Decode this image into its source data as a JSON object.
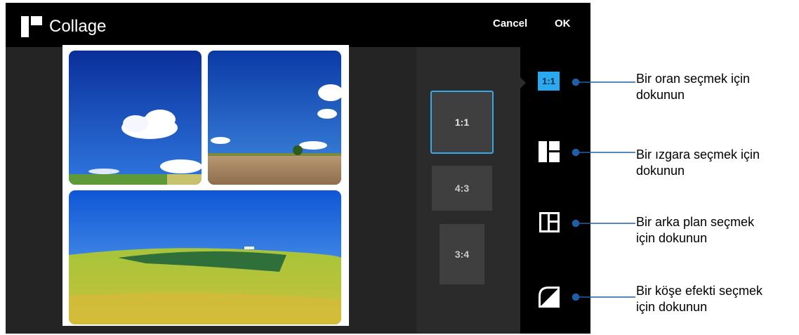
{
  "header": {
    "title": "Collage",
    "cancel_label": "Cancel",
    "ok_label": "OK"
  },
  "ratios": {
    "options": [
      "1:1",
      "4:3",
      "3:4"
    ],
    "selected": "1:1"
  },
  "tools": {
    "ratio_label": "1:1",
    "icons": [
      "ratio-icon",
      "grid-icon",
      "background-icon",
      "corner-effect-icon"
    ]
  },
  "annotations": [
    {
      "line1": "Bir oran seçmek için",
      "line2": "dokunun"
    },
    {
      "line1": "Bir ızgara seçmek için",
      "line2": "dokunun"
    },
    {
      "line1": "Bir arka plan seçmek",
      "line2": "için dokunun"
    },
    {
      "line1": "Bir köşe efekti seçmek",
      "line2": "için dokunun"
    }
  ],
  "colors": {
    "accent": "#29aaf0",
    "selection_border": "#3aa8e8",
    "callout_line": "#1f5fa8"
  }
}
